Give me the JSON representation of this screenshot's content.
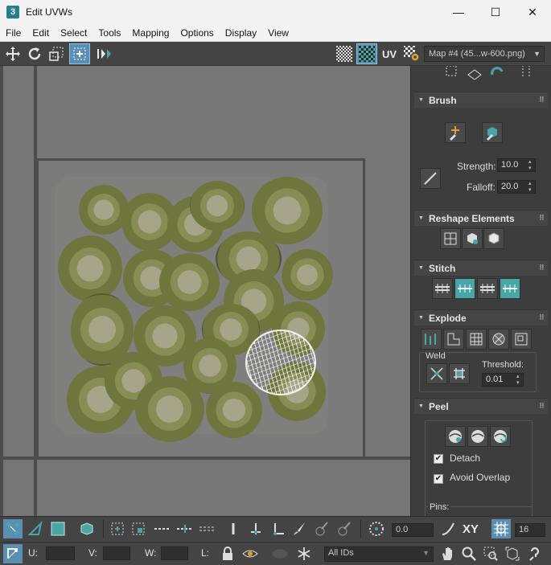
{
  "window": {
    "app_icon_text": "3",
    "title": "Edit UVWs",
    "minimize": "—",
    "maximize": "☐",
    "close": "✕"
  },
  "menu": [
    "File",
    "Edit",
    "Select",
    "Tools",
    "Mapping",
    "Options",
    "Display",
    "View"
  ],
  "toolbar": {
    "uv_label": "UV",
    "map_select": "Map #4 (45...w-600.png)"
  },
  "brush": {
    "title": "Brush",
    "strength_label": "Strength:",
    "strength_value": "10.0",
    "falloff_label": "Falloff:",
    "falloff_value": "20.0"
  },
  "reshape": {
    "title": "Reshape Elements"
  },
  "stitch": {
    "title": "Stitch"
  },
  "explode": {
    "title": "Explode",
    "weld_label": "Weld",
    "threshold_label": "Threshold:",
    "threshold_value": "0.01"
  },
  "peel": {
    "title": "Peel",
    "detach_label": "Detach",
    "avoid_overlap_label": "Avoid Overlap",
    "pins_label": "Pins:"
  },
  "bottom": {
    "rotation_value": "0.0",
    "xy_label": "XY",
    "grid_value": "16",
    "u_label": "U:",
    "v_label": "V:",
    "w_label": "W:",
    "l_label": "L:",
    "ids_select": "All IDs"
  },
  "colors": {
    "accent_teal": "#48a7a6",
    "selected_blue": "#5a8fb3",
    "panel_bg": "#3d3d3d",
    "viewport_bg": "#767676"
  }
}
